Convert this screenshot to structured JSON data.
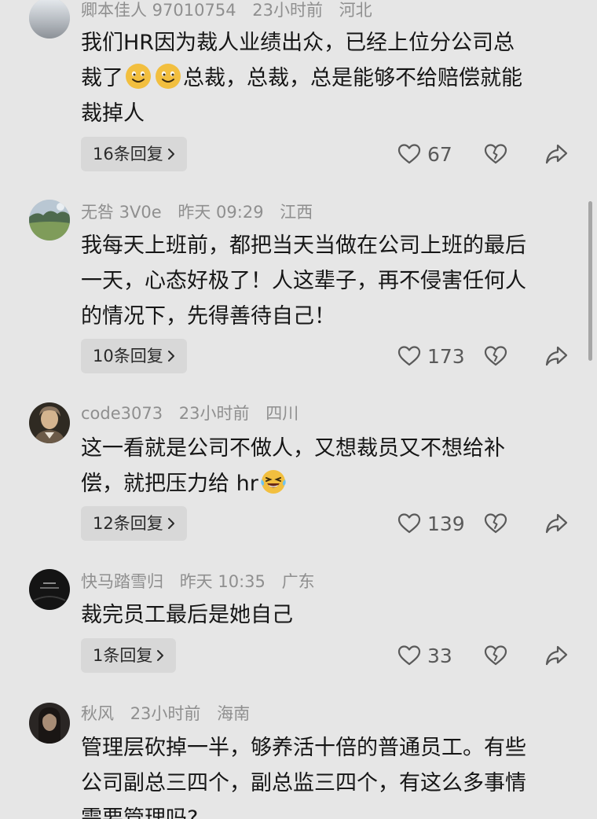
{
  "comments": [
    {
      "username": "卿本佳人 97010754",
      "time": "23小时前",
      "location": "河北",
      "avatar": "grey-gradient-avatar",
      "lines": [
        "我们HR因为裁人业绩出众，已经上位分公司总",
        "裁了",
        "总裁，总裁，总是能够不给赔偿就能",
        "裁掉人"
      ],
      "emoji": "smile-emoji",
      "replies": "16条回复",
      "likes": "67"
    },
    {
      "username": "无咎 3V0e",
      "time": "昨天 09:29",
      "location": "江西",
      "avatar": "landscape-avatar",
      "lines": [
        "我每天上班前，都把当天当做在公司上班的最后",
        "一天，心态好极了！人这辈子，再不侵害任何人",
        "的情况下，先得善待自己！"
      ],
      "replies": "10条回复",
      "likes": "173"
    },
    {
      "username": "code3073",
      "time": "23小时前",
      "location": "四川",
      "avatar": "portrait-painting-avatar",
      "lines": [
        "这一看就是公司不做人，又想裁员又不想给补",
        "偿，就把压力给 hr"
      ],
      "emoji": "laughing-tears-emoji",
      "replies": "12条回复",
      "likes": "139"
    },
    {
      "username": "快马踏雪归",
      "time": "昨天 10:35",
      "location": "广东",
      "avatar": "dark-avatar",
      "lines": [
        "裁完员工最后是她自己"
      ],
      "replies": "1条回复",
      "likes": "33"
    },
    {
      "username": "秋风",
      "time": "23小时前",
      "location": "海南",
      "avatar": "long-hair-portrait-avatar",
      "lines": [
        "管理层砍掉一半，够养活十倍的普通员工。有些",
        "公司副总三四个，副总监三四个，有这么多事情",
        "需要管理吗?"
      ]
    }
  ],
  "icons": {
    "like": "heart-outline-icon",
    "dislike": "broken-heart-icon",
    "share": "share-arrow-icon",
    "reply_chevron": "chevron-right-icon"
  },
  "colors": {
    "background": "#e6e6e6",
    "text": "#161616",
    "meta": "#8f8f8f",
    "reply_button": "#d8d8d8",
    "icon": "#5a5a5a",
    "emoji": "#f2bf3f"
  }
}
